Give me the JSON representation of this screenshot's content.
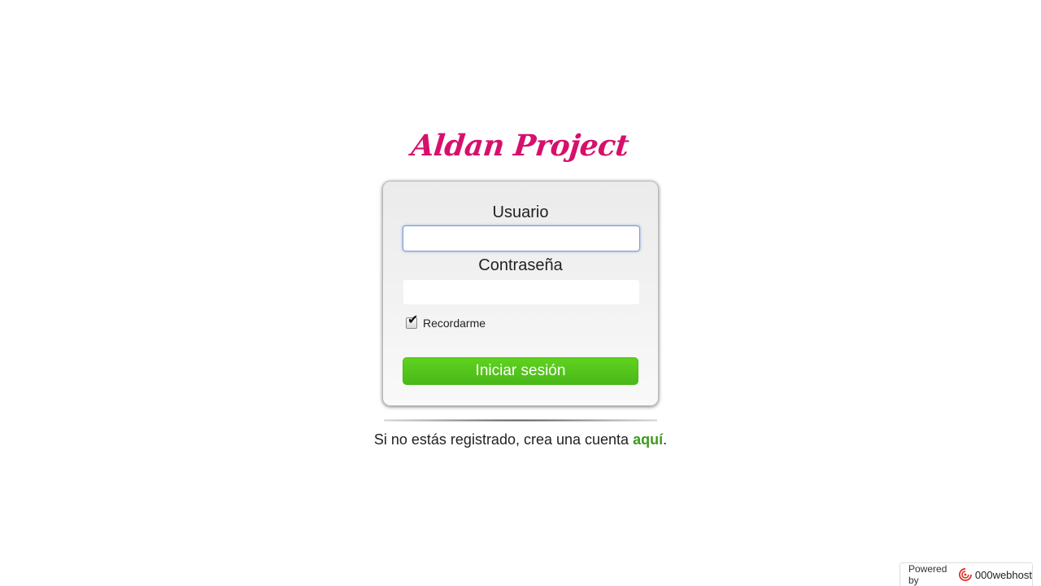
{
  "logo": {
    "text": "Aldan Project",
    "icon": "gamepad-icon",
    "color": "#d6106c"
  },
  "login_form": {
    "username_label": "Usuario",
    "username_value": "",
    "password_label": "Contraseña",
    "password_value": "",
    "remember_label": "Recordarme",
    "remember_checked": true,
    "submit_label": "Iniciar sesión"
  },
  "register": {
    "prefix": "Si no estás registrado, crea una cuenta ",
    "link_text": "aquí",
    "suffix": "."
  },
  "footer": {
    "powered_by": "Powered by",
    "brand": "000webhost"
  },
  "colors": {
    "button_green": "#54c41b",
    "link_green": "#3f9a1e",
    "brand_pink": "#d6106c"
  }
}
